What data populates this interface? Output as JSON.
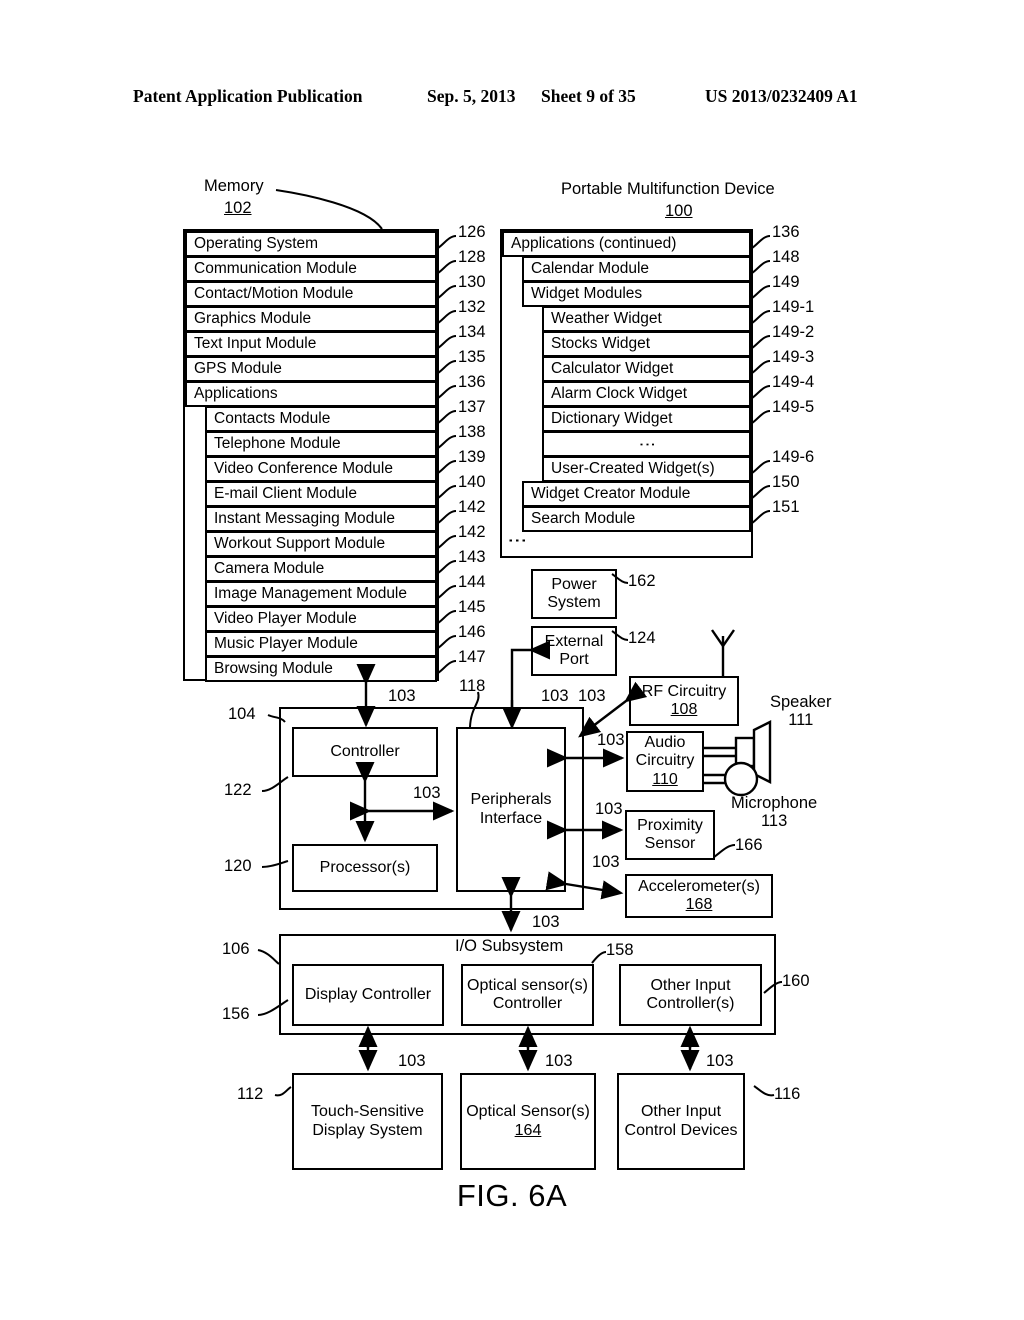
{
  "header": {
    "publication": "Patent Application Publication",
    "date": "Sep. 5, 2013",
    "sheet": "Sheet 9 of 35",
    "number": "US 2013/0232409 A1"
  },
  "figure_caption": "FIG. 6A",
  "memory": {
    "title": "Memory",
    "ref": "102",
    "rows": [
      {
        "label": "Operating System",
        "ref": "126",
        "indent": 0
      },
      {
        "label": "Communication Module",
        "ref": "128",
        "indent": 0
      },
      {
        "label": "Contact/Motion Module",
        "ref": "130",
        "indent": 0
      },
      {
        "label": "Graphics Module",
        "ref": "132",
        "indent": 0
      },
      {
        "label": "Text Input Module",
        "ref": "134",
        "indent": 0
      },
      {
        "label": "GPS Module",
        "ref": "135",
        "indent": 0
      },
      {
        "label": "Applications",
        "ref": "136",
        "indent": 0
      },
      {
        "label": "Contacts Module",
        "ref": "137",
        "indent": 1
      },
      {
        "label": "Telephone Module",
        "ref": "138",
        "indent": 1
      },
      {
        "label": "Video Conference Module",
        "ref": "139",
        "indent": 1
      },
      {
        "label": "E-mail Client Module",
        "ref": "140",
        "indent": 1
      },
      {
        "label": "Instant Messaging Module",
        "ref": "142",
        "indent": 1
      },
      {
        "label": "Workout Support Module",
        "ref": "142",
        "indent": 1
      },
      {
        "label": "Camera Module",
        "ref": "143",
        "indent": 1
      },
      {
        "label": "Image Management Module",
        "ref": "144",
        "indent": 1
      },
      {
        "label": "Video Player Module",
        "ref": "145",
        "indent": 1
      },
      {
        "label": "Music Player Module",
        "ref": "146",
        "indent": 1
      },
      {
        "label": "Browsing Module",
        "ref": "147",
        "indent": 1
      }
    ]
  },
  "device": {
    "title": "Portable Multifunction Device",
    "ref": "100",
    "rows": [
      {
        "label": "Applications (continued)",
        "ref": "136",
        "indent": 0
      },
      {
        "label": "Calendar Module",
        "ref": "148",
        "indent": 1
      },
      {
        "label": "Widget Modules",
        "ref": "149",
        "indent": 1
      },
      {
        "label": "Weather Widget",
        "ref": "149-1",
        "indent": 2
      },
      {
        "label": "Stocks Widget",
        "ref": "149-2",
        "indent": 2
      },
      {
        "label": "Calculator Widget",
        "ref": "149-3",
        "indent": 2
      },
      {
        "label": "Alarm Clock Widget",
        "ref": "149-4",
        "indent": 2
      },
      {
        "label": "Dictionary Widget",
        "ref": "149-5",
        "indent": 2
      },
      {
        "label": "",
        "ref": "",
        "indent": 2,
        "ellipsis": true
      },
      {
        "label": "User-Created Widget(s)",
        "ref": "149-6",
        "indent": 2
      },
      {
        "label": "Widget Creator Module",
        "ref": "150",
        "indent": 1
      },
      {
        "label": "Search Module",
        "ref": "151",
        "indent": 1
      }
    ]
  },
  "blocks": {
    "power_system": {
      "label": "Power System",
      "ref": "162"
    },
    "external_port": {
      "label": "External Port",
      "ref": "124"
    },
    "rf_circuitry": {
      "label": "RF Circuitry",
      "ref": "108"
    },
    "audio_circuitry": {
      "label": "Audio Circuitry",
      "ref": "110"
    },
    "proximity": {
      "label": "Proximity Sensor",
      "ref": "166"
    },
    "accelerometer": {
      "label": "Accelerometer(s)",
      "ref": "168"
    },
    "controller": {
      "label": "Controller",
      "ref": "122"
    },
    "processor": {
      "label": "Processor(s)",
      "ref": "120"
    },
    "peripherals": {
      "label": "Peripherals Interface",
      "ref": "118"
    },
    "cpu_group": {
      "label": "",
      "ref": "104"
    },
    "io_subsystem": {
      "label": "I/O Subsystem",
      "ref": "106"
    },
    "display_ctrl": {
      "label": "Display Controller",
      "ref": "156"
    },
    "optical_ctrl": {
      "label": "Optical sensor(s) Controller",
      "ref": "158"
    },
    "other_in_ctrl": {
      "label": "Other Input Controller(s)",
      "ref": "160"
    },
    "touch_display": {
      "label": "Touch-Sensitive Display System",
      "ref": "112"
    },
    "optical_sensor": {
      "label": "Optical Sensor(s)",
      "ref": "164"
    },
    "other_in_dev": {
      "label": "Other Input Control Devices",
      "ref": "116"
    },
    "speaker": {
      "label": "Speaker",
      "ref": "111"
    },
    "microphone": {
      "label": "Microphone",
      "ref": "113"
    }
  },
  "bus_label": "103",
  "bus_labels": [
    "103",
    "103",
    "103",
    "103",
    "103",
    "103",
    "103",
    "103",
    "103",
    "103",
    "103",
    "103",
    "103"
  ]
}
